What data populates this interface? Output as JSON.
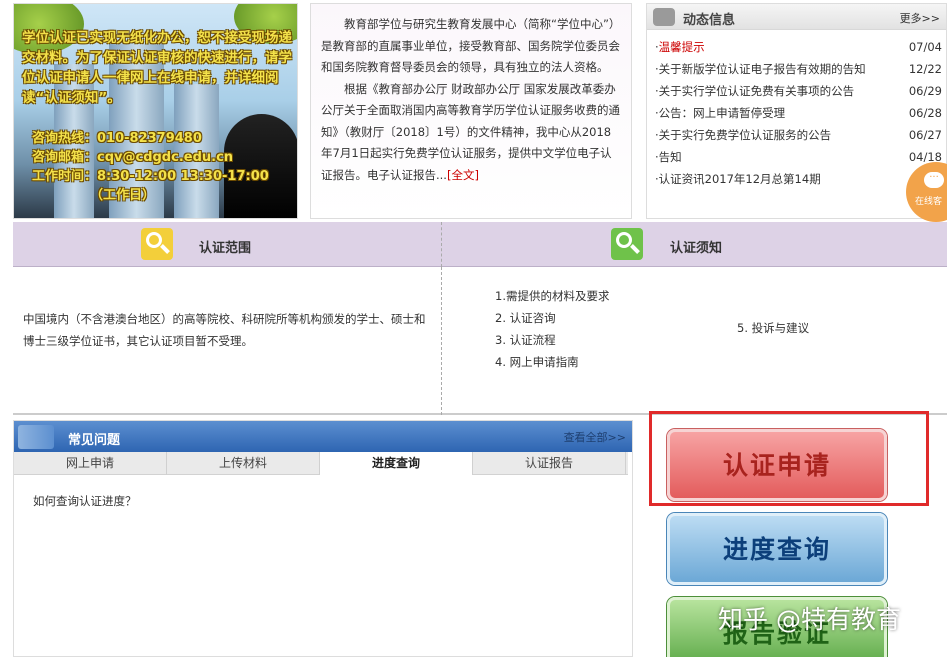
{
  "banner": {
    "text": "学位认证已实现无纸化办公，恕不接受现场递交材料。为了保证认证审核的快速进行，请学位认证申请人一律网上在线申请，并详细阅读“认证须知”。",
    "hotline": "咨询热线：010-82379480",
    "email": "咨询邮箱：cqv@cdgdc.edu.cn",
    "hours": "工作时间：8:30-12:00 13:30-17:00",
    "workday": "（工作日）"
  },
  "intro": {
    "para1": "教育部学位与研究生教育发展中心（简称“学位中心”）是教育部的直属事业单位，接受教育部、国务院学位委员会和国务院教育督导委员会的领导，具有独立的法人资格。",
    "para2": "根据《教育部办公厅 财政部办公厅 国家发展改革委办公厅关于全面取消国内高等教育学历学位认证服务收费的通知》（教财厅〔2018〕1号）的文件精神，我中心从2018年7月1日起实行免费学位认证服务，提供中文学位电子认证报告。电子认证报告...",
    "more": "[全文]"
  },
  "news": {
    "title": "动态信息",
    "more": "更多>>",
    "items": [
      {
        "title": "温馨提示",
        "date": "07/04"
      },
      {
        "title": "关于新版学位认证电子报告有效期的告知",
        "date": "12/22"
      },
      {
        "title": "关于实行学位认证免费有关事项的公告",
        "date": "06/29"
      },
      {
        "title": "公告：网上申请暂停受理",
        "date": "06/28"
      },
      {
        "title": "关于实行免费学位认证服务的公告",
        "date": "06/27"
      },
      {
        "title": "告知",
        "date": "04/18"
      },
      {
        "title": "认证资讯2017年12月总第14期",
        "date": ""
      }
    ]
  },
  "float": {
    "label": "在线客"
  },
  "scope": {
    "title": "认证范围",
    "text": "中国境内（不含港澳台地区）的高等院校、科研院所等机构颁发的学士、硕士和博士三级学位证书，其它认证项目暂不受理。"
  },
  "notice": {
    "title": "认证须知",
    "steps": [
      "1.需提供的材料及要求",
      "2. 认证咨询",
      "3. 认证流程",
      "4. 网上申请指南"
    ],
    "step5": "5. 投诉与建议"
  },
  "faq": {
    "title": "常见问题",
    "more": "查看全部>>",
    "tabs": [
      "网上申请",
      "上传材料",
      "进度查询",
      "认证报告"
    ],
    "question": "如何查询认证进度？"
  },
  "buttons": {
    "apply": "认证申请",
    "progress": "进度查询",
    "verify": "报告验证"
  },
  "watermark": "知乎 @特有教育",
  "colors": {
    "highlight": "#e02a2a",
    "faq_header": "#2e65b2",
    "section_header": "#ddd2e6"
  }
}
